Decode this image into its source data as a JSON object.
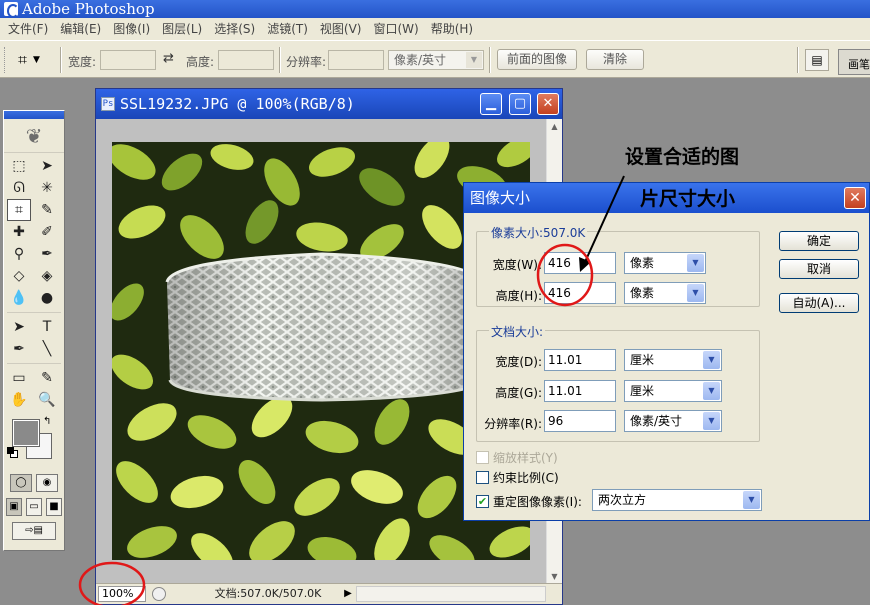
{
  "app": {
    "title": "Adobe Photoshop"
  },
  "menu": [
    "文件(F)",
    "编辑(E)",
    "图像(I)",
    "图层(L)",
    "选择(S)",
    "滤镜(T)",
    "视图(V)",
    "窗口(W)",
    "帮助(H)"
  ],
  "options": {
    "width_label": "宽度:",
    "height_label": "高度:",
    "resolution_label": "分辨率:",
    "unit_select": "像素/英寸",
    "front_image_button": "前面的图像",
    "clear_button": "清除",
    "palette_tab": "画笔"
  },
  "document": {
    "title": "SSL19232.JPG @ 100%(RGB/8)",
    "zoom": "100%",
    "status": "文档:507.0K/507.0K"
  },
  "dialog": {
    "title": "图像大小",
    "pixel_dims_legend": "像素大小:507.0K",
    "pixel_width_label": "宽度(W):",
    "pixel_width_value": "416",
    "pixel_width_unit": "像素",
    "pixel_height_label": "高度(H):",
    "pixel_height_value": "416",
    "pixel_height_unit": "像素",
    "doc_size_legend": "文档大小:",
    "doc_width_label": "宽度(D):",
    "doc_width_value": "11.01",
    "doc_width_unit": "厘米",
    "doc_height_label": "高度(G):",
    "doc_height_value": "11.01",
    "doc_height_unit": "厘米",
    "resolution_label": "分辨率(R):",
    "resolution_value": "96",
    "resolution_unit": "像素/英寸",
    "scale_styles_label": "缩放样式(Y)",
    "constrain_label": "约束比例(C)",
    "resample_label": "重定图像像素(I):",
    "resample_method": "两次立方",
    "ok_button": "确定",
    "cancel_button": "取消",
    "auto_button": "自动(A)...",
    "close_glyph": "✕"
  },
  "annotation": {
    "line1": "设置合适的图",
    "line2": "片尺寸大小",
    "highlight_color": "#e01818"
  }
}
